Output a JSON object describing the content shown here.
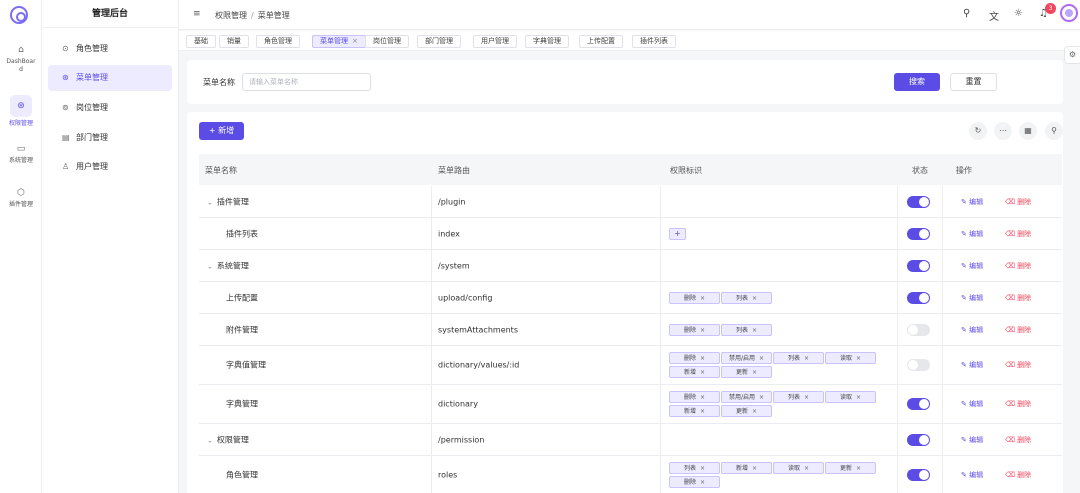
{
  "app": {
    "title": "管理后台"
  },
  "rail": [
    {
      "label": "DashBoard",
      "icon": "home-icon"
    },
    {
      "label": "权限管理",
      "icon": "shield-icon",
      "active": true
    },
    {
      "label": "系统管理",
      "icon": "system-icon"
    },
    {
      "label": "插件管理",
      "icon": "box-icon"
    }
  ],
  "sidebar": {
    "items": [
      {
        "label": "角色管理",
        "icon": "role-icon"
      },
      {
        "label": "菜单管理",
        "icon": "menu-icon",
        "active": true
      },
      {
        "label": "岗位管理",
        "icon": "post-icon"
      },
      {
        "label": "部门管理",
        "icon": "dept-icon"
      },
      {
        "label": "用户管理",
        "icon": "user-icon"
      }
    ]
  },
  "header": {
    "breadcrumb": [
      "权限管理",
      "菜单管理"
    ],
    "breadcrumb_sep": "/",
    "notifications": "3",
    "icons": [
      "search-icon",
      "translate-icon",
      "sun-icon",
      "bell-icon",
      "avatar"
    ]
  },
  "tabs": [
    {
      "label": "基础"
    },
    {
      "label": "销量"
    },
    {
      "label": "角色管理"
    },
    {
      "label": "菜单管理",
      "active": true,
      "closable": true
    },
    {
      "label": "岗位管理"
    },
    {
      "label": "部门管理"
    },
    {
      "label": "用户管理"
    },
    {
      "label": "字典管理"
    },
    {
      "label": "上传配置"
    },
    {
      "label": "插件列表"
    }
  ],
  "search": {
    "label": "菜单名称",
    "placeholder": "请输入菜单名称",
    "value": "",
    "search_button": "搜索",
    "reset_button": "重置"
  },
  "table": {
    "add_button": "新增",
    "add_icon": "+",
    "tools": [
      "refresh-icon",
      "more-icon",
      "columns-icon",
      "search-icon"
    ],
    "columns": [
      "菜单名称",
      "菜单路由",
      "权限标识",
      "状态",
      "操作"
    ],
    "edit_label": "编辑",
    "delete_label": "删除",
    "rows": [
      {
        "name": "插件管理",
        "level": 0,
        "expanded": true,
        "route": "/plugin",
        "perms": [],
        "perm_add": false,
        "enabled": true
      },
      {
        "name": "插件列表",
        "level": 1,
        "route": "index",
        "perms": [],
        "perm_add": true,
        "enabled": true
      },
      {
        "name": "系统管理",
        "level": 0,
        "expanded": true,
        "route": "/system",
        "perms": [],
        "perm_add": false,
        "enabled": true
      },
      {
        "name": "上传配置",
        "level": 1,
        "route": "upload/config",
        "perms": [
          "删除",
          "列表"
        ],
        "enabled": true
      },
      {
        "name": "附件管理",
        "level": 1,
        "route": "systemAttachments",
        "perms": [
          "删除",
          "列表"
        ],
        "enabled": false
      },
      {
        "name": "字典值管理",
        "level": 1,
        "route": "dictionary/values/:id",
        "perms": [
          "删除",
          "禁用/启用",
          "列表",
          "读取",
          "新增",
          "更新"
        ],
        "enabled": false
      },
      {
        "name": "字典管理",
        "level": 1,
        "route": "dictionary",
        "perms": [
          "删除",
          "禁用/启用",
          "列表",
          "读取",
          "新增",
          "更新"
        ],
        "enabled": true
      },
      {
        "name": "权限管理",
        "level": 0,
        "expanded": true,
        "route": "/permission",
        "perms": [],
        "perm_add": false,
        "enabled": true
      },
      {
        "name": "角色管理",
        "level": 1,
        "route": "roles",
        "perms": [
          "列表",
          "新增",
          "读取",
          "更新",
          "删除"
        ],
        "enabled": true
      }
    ]
  },
  "colors": {
    "primary": "#5b4ce6",
    "danger": "#f0455d",
    "chip_bg": "#ecebff"
  }
}
